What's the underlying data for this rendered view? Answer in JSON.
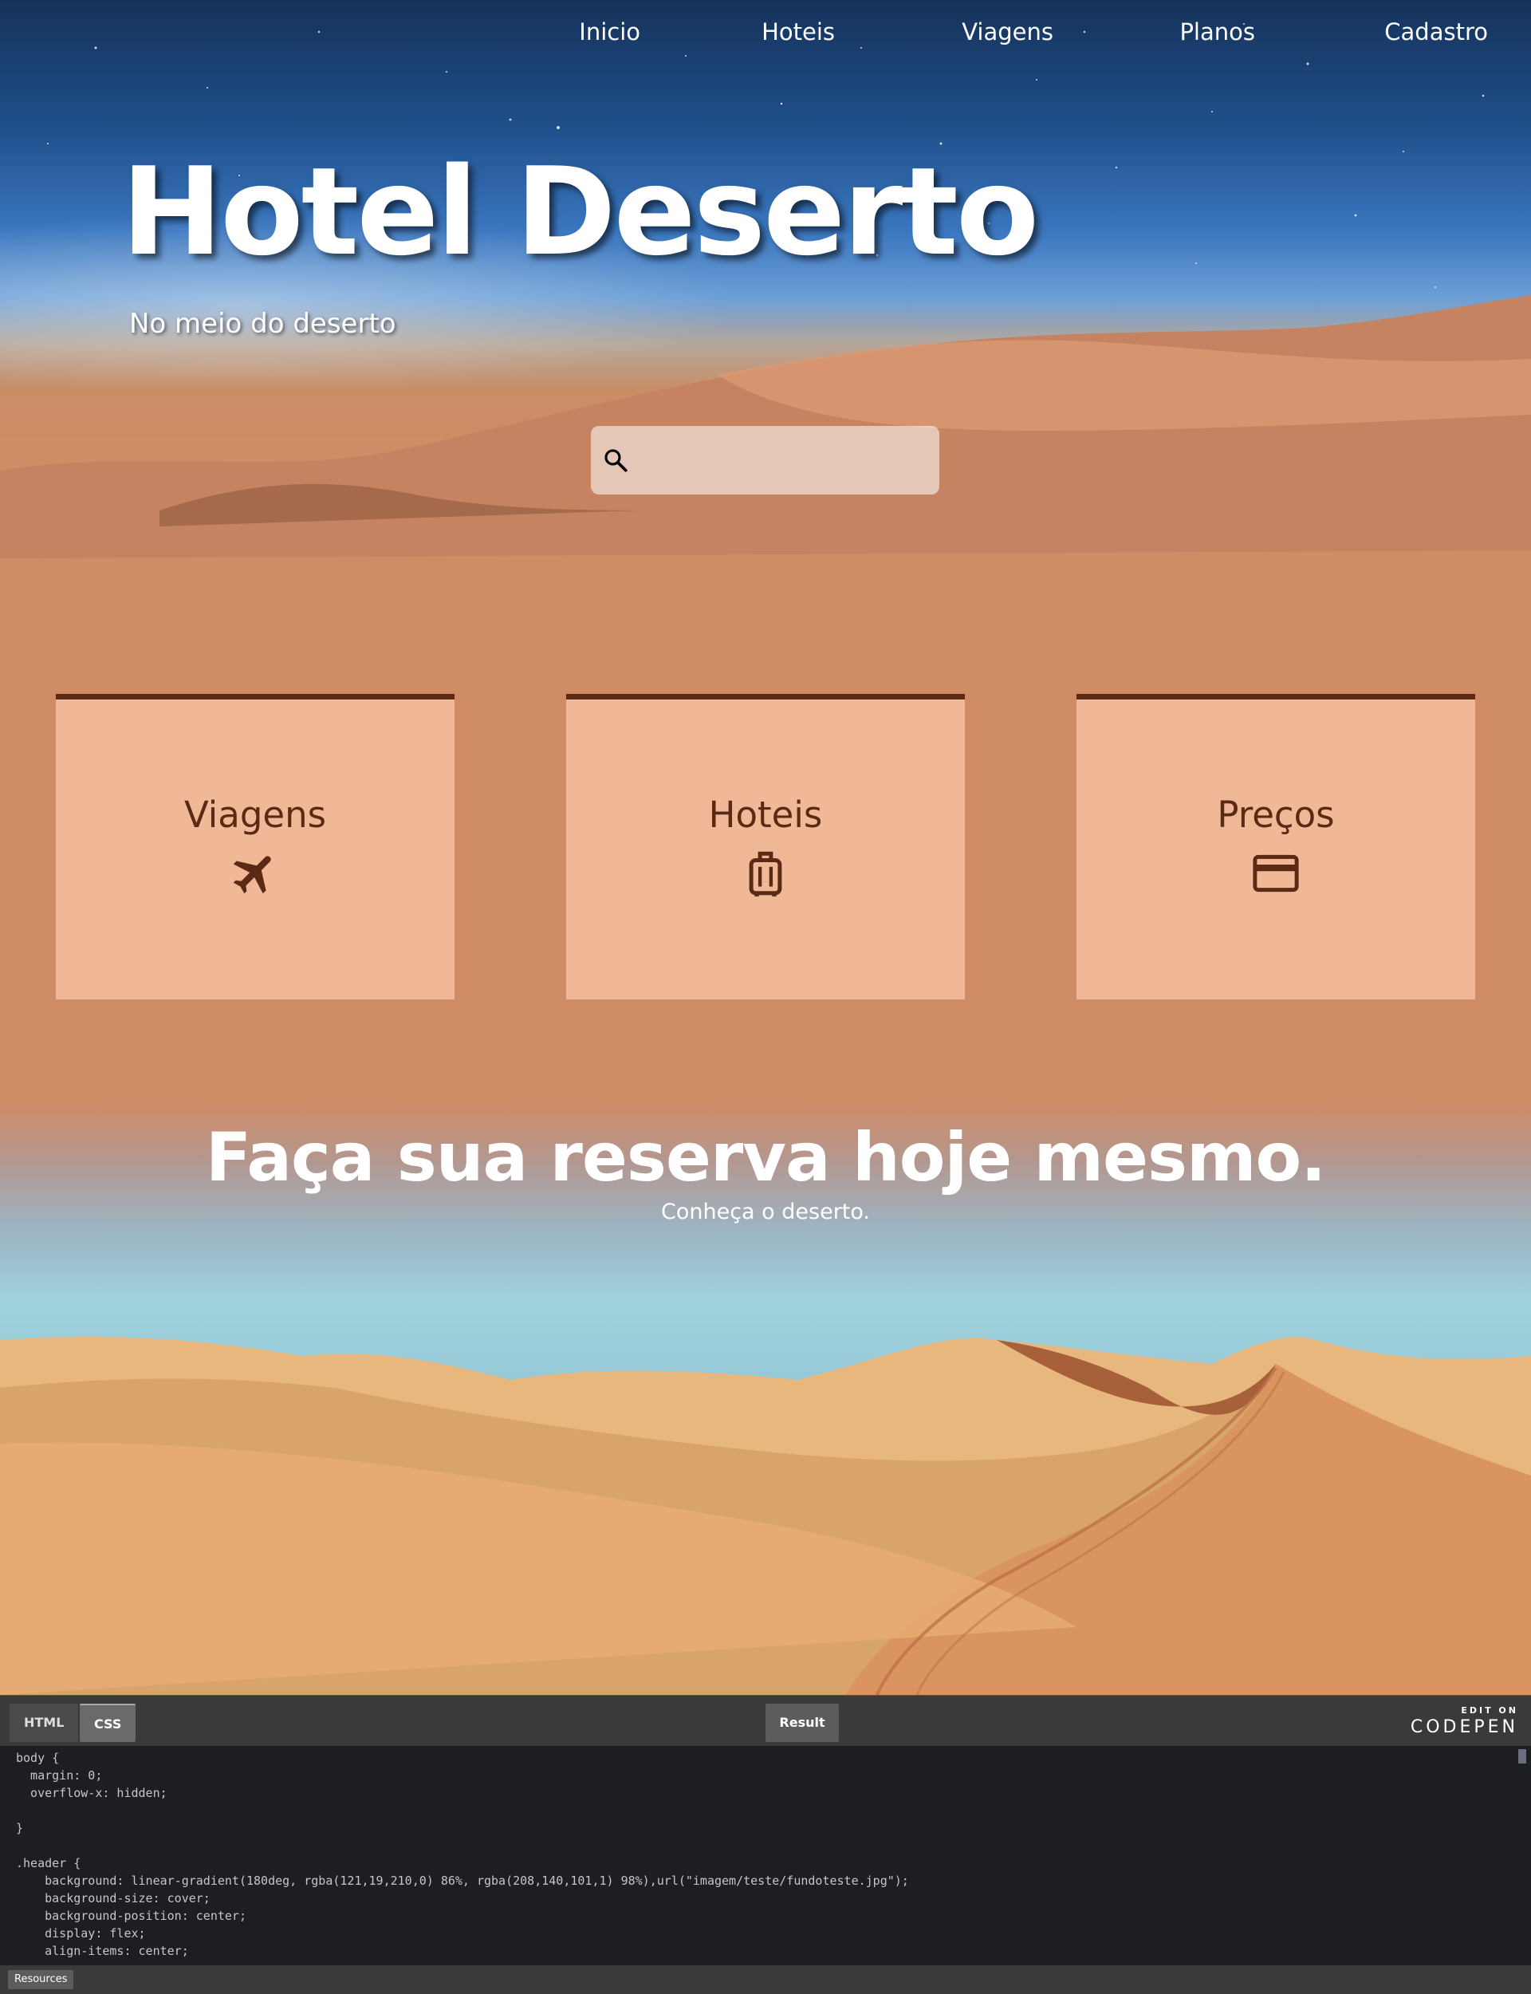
{
  "nav": {
    "items": [
      "Inicio",
      "Hoteis",
      "Viagens",
      "Planos",
      "Cadastro"
    ]
  },
  "hero": {
    "title": "Hotel Deserto",
    "subtitle": "No meio do deserto",
    "search_placeholder": ""
  },
  "cards": [
    {
      "label": "Viagens",
      "icon": "airplane-icon"
    },
    {
      "label": "Hoteis",
      "icon": "luggage-icon"
    },
    {
      "label": "Preços",
      "icon": "credit-card-icon"
    }
  ],
  "cta": {
    "title": "Faça sua reserva hoje mesmo.",
    "subtitle": "Conheça o deserto."
  },
  "codepen": {
    "tabs": [
      "HTML",
      "CSS"
    ],
    "active_tab": "CSS",
    "result_label": "Result",
    "edit_on": "EDIT ON",
    "brand": "CODEPEN",
    "resources_label": "Resources",
    "code_lines": [
      "body {",
      "  margin: 0;",
      "  overflow-x: hidden;",
      "",
      "}",
      "",
      ".header {",
      "    background: linear-gradient(180deg, rgba(121,19,210,0) 86%, rgba(208,140,101,1) 98%),url(\"imagem/teste/fundoteste.jpg\");",
      "    background-size: cover;",
      "    background-position: center;",
      "    display: flex;",
      "    align-items: center;"
    ]
  },
  "colors": {
    "sand": "#d08c65",
    "card": "#f0b896",
    "card_accent": "#5a2a14",
    "code_bg": "#1d1e22"
  }
}
